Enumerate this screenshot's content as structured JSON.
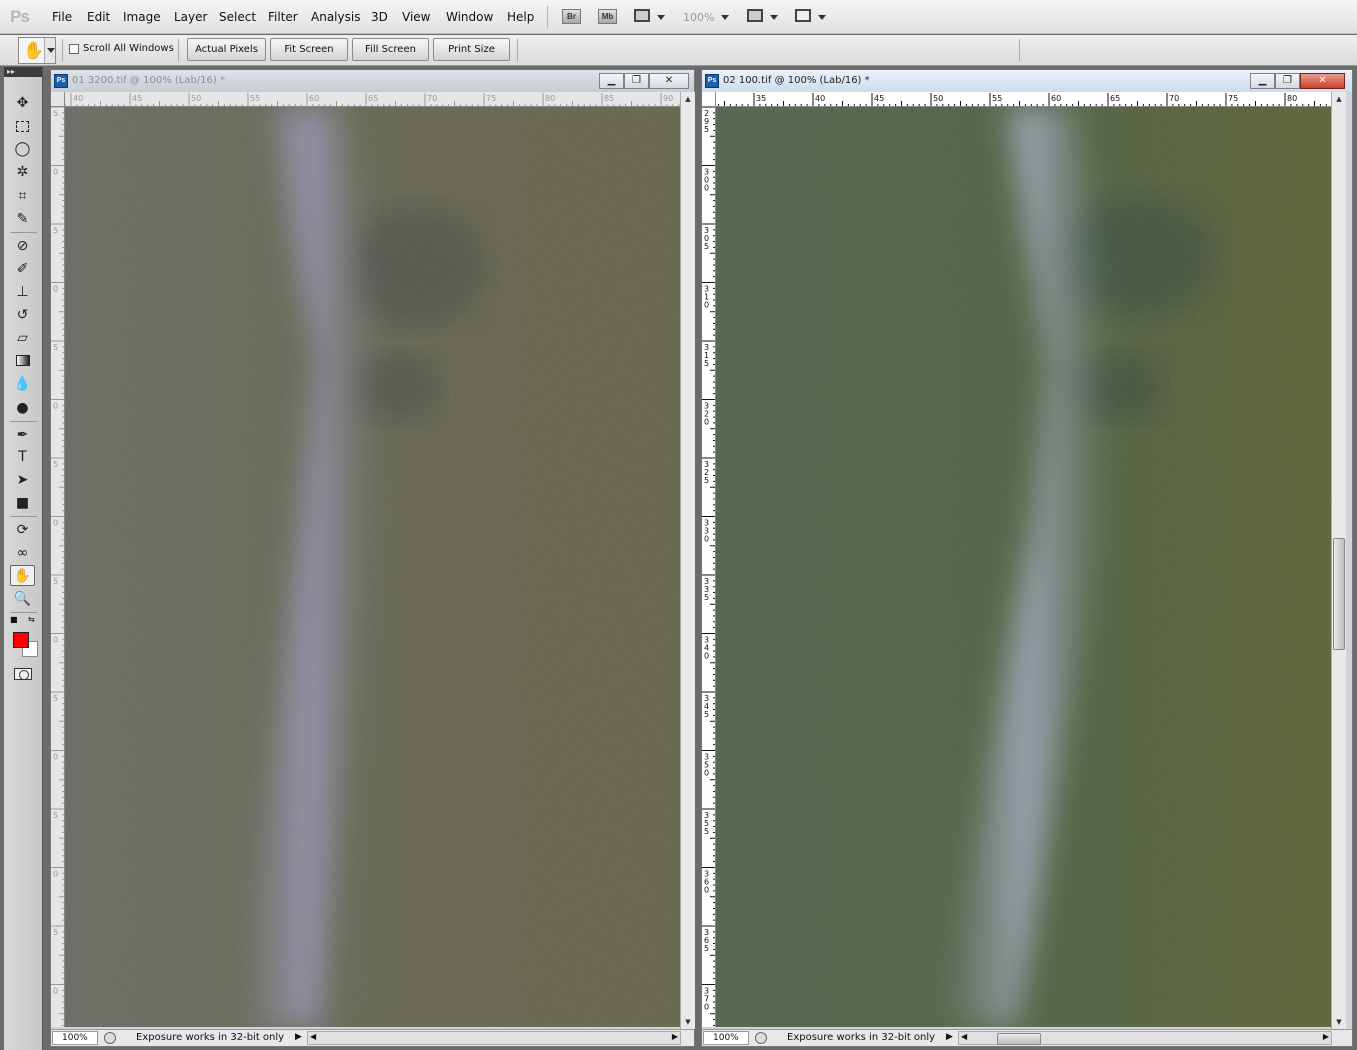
{
  "app": {
    "logo": "Ps"
  },
  "menu": [
    "File",
    "Edit",
    "Image",
    "Layer",
    "Select",
    "Filter",
    "Analysis",
    "3D",
    "View",
    "Window",
    "Help"
  ],
  "appbar": {
    "bridge_label": "Br",
    "minibridge_label": "Mb",
    "zoom_level": "100%"
  },
  "options": {
    "scroll_all_windows_label": "Scroll All Windows",
    "scroll_all_windows_checked": false,
    "buttons": [
      "Actual Pixels",
      "Fit Screen",
      "Fill Screen",
      "Print Size"
    ]
  },
  "tools": [
    {
      "name": "move-tool",
      "icon": "move-icon"
    },
    {
      "name": "marquee-tool",
      "icon": "rect-marquee-icon"
    },
    {
      "name": "lasso-tool",
      "icon": "lasso-icon"
    },
    {
      "name": "quick-selection-tool",
      "icon": "magic-wand-icon"
    },
    {
      "name": "crop-tool",
      "icon": "crop-icon"
    },
    {
      "name": "eyedropper-tool",
      "icon": "eyedropper-icon"
    },
    {
      "name": "healing-brush-tool",
      "icon": "bandage-icon"
    },
    {
      "name": "brush-tool",
      "icon": "brush-icon"
    },
    {
      "name": "clone-stamp-tool",
      "icon": "stamp-icon"
    },
    {
      "name": "history-brush-tool",
      "icon": "history-brush-icon"
    },
    {
      "name": "eraser-tool",
      "icon": "eraser-icon"
    },
    {
      "name": "gradient-tool",
      "icon": "gradient-icon"
    },
    {
      "name": "blur-tool",
      "icon": "drop-icon"
    },
    {
      "name": "dodge-tool",
      "icon": "dodge-icon"
    },
    {
      "name": "pen-tool",
      "icon": "pen-icon"
    },
    {
      "name": "type-tool",
      "icon": "type-icon"
    },
    {
      "name": "path-selection-tool",
      "icon": "arrow-icon"
    },
    {
      "name": "shape-tool",
      "icon": "rectangle-icon"
    },
    {
      "name": "3d-rotate-tool",
      "icon": "3d-rotate-icon"
    },
    {
      "name": "3d-orbit-tool",
      "icon": "3d-orbit-icon"
    },
    {
      "name": "hand-tool",
      "icon": "hand-icon",
      "active": true
    },
    {
      "name": "zoom-tool",
      "icon": "zoom-icon"
    }
  ],
  "colors": {
    "foreground": "#ff0000",
    "background": "#ffffff"
  },
  "documents": [
    {
      "title": "01 3200.tif @ 100% (Lab/16) *",
      "active": false,
      "hruler": [
        "40",
        "45",
        "50",
        "55",
        "60",
        "65",
        "70",
        "75",
        "80",
        "85",
        "90"
      ],
      "vruler": [
        "5",
        "0",
        "5",
        "0",
        "5",
        "0",
        "5",
        "0",
        "5",
        "0",
        "5",
        "0",
        "5",
        "0",
        "5",
        "0",
        "5"
      ],
      "zoom": "100%",
      "status": "Exposure works in 32-bit only"
    },
    {
      "title": "02 100.tif @ 100% (Lab/16) *",
      "active": true,
      "hruler": [
        "35",
        "40",
        "45",
        "50",
        "55",
        "60",
        "65",
        "70",
        "75",
        "80"
      ],
      "vruler": [
        "295",
        "300",
        "305",
        "310",
        "315",
        "320",
        "325",
        "330",
        "335",
        "340",
        "345",
        "350",
        "355",
        "360",
        "365",
        "370"
      ],
      "zoom": "100%",
      "status": "Exposure works in 32-bit only"
    }
  ]
}
